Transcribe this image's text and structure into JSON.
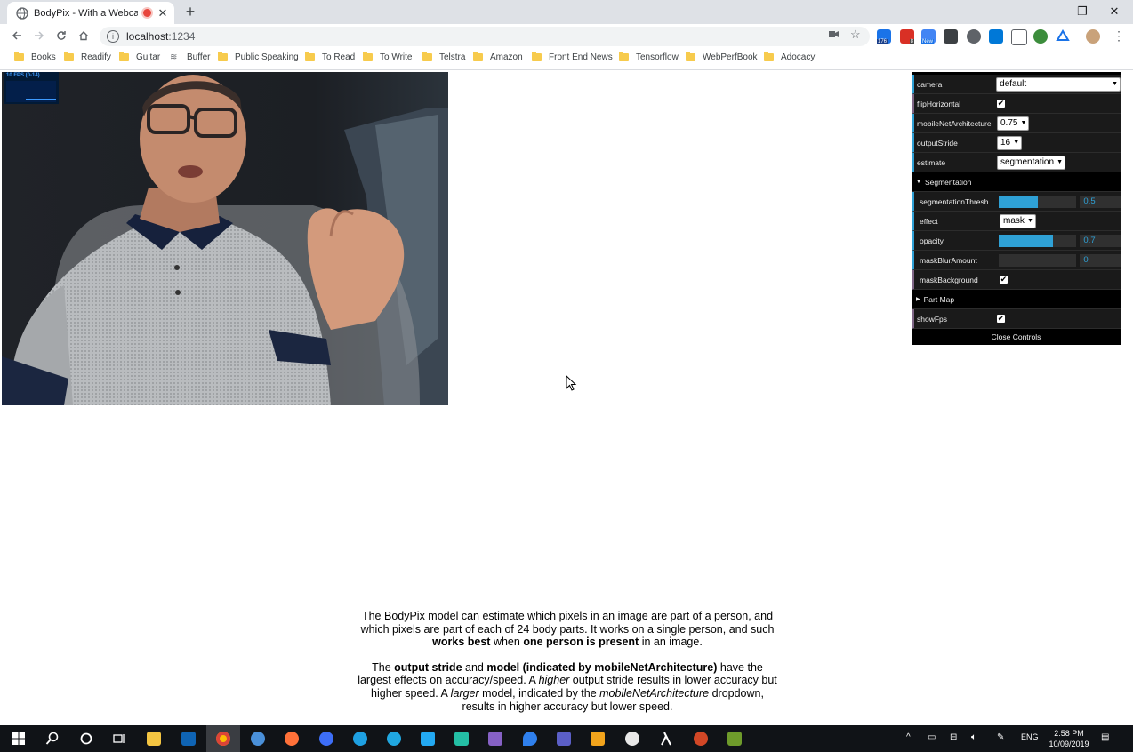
{
  "browser": {
    "tab_title": "BodyPix - With a Webcam D",
    "tab_close": "✕",
    "new_tab": "+",
    "url_host": "localhost",
    "url_port": ":1234",
    "window_controls": [
      "—",
      "❐",
      "✕"
    ],
    "extension_badges": [
      "176",
      "8",
      "New"
    ]
  },
  "bookmarks": [
    {
      "label": "Books",
      "icon": "folder-icon"
    },
    {
      "label": "Readify",
      "icon": "folder-icon"
    },
    {
      "label": "Guitar",
      "icon": "folder-icon"
    },
    {
      "label": "Buffer",
      "icon": "buffer-icon"
    },
    {
      "label": "Public Speaking",
      "icon": "folder-icon"
    },
    {
      "label": "To Read",
      "icon": "folder-icon"
    },
    {
      "label": "To Write",
      "icon": "folder-icon"
    },
    {
      "label": "Telstra",
      "icon": "folder-icon"
    },
    {
      "label": "Amazon",
      "icon": "folder-icon"
    },
    {
      "label": "Front End News",
      "icon": "folder-icon"
    },
    {
      "label": "Tensorflow",
      "icon": "folder-icon"
    },
    {
      "label": "WebPerfBook",
      "icon": "folder-icon"
    },
    {
      "label": "Adocacy",
      "icon": "folder-icon"
    }
  ],
  "stats": {
    "fps_label": "10 FPS (0-14)"
  },
  "gui": {
    "camera": {
      "label": "camera",
      "value": "default"
    },
    "flipHorizontal": {
      "label": "flipHorizontal",
      "checked": true
    },
    "mobileNetArchitecture": {
      "label": "mobileNetArchitecture",
      "value": "0.75"
    },
    "outputStride": {
      "label": "outputStride",
      "value": "16"
    },
    "estimate": {
      "label": "estimate",
      "value": "segmentation"
    },
    "segmentation_folder": "Segmentation",
    "segmentationThreshold": {
      "label": "segmentationThresh..",
      "value": "0.5",
      "fraction": 0.5
    },
    "effect": {
      "label": "effect",
      "value": "mask"
    },
    "opacity": {
      "label": "opacity",
      "value": "0.7",
      "fraction": 0.7
    },
    "maskBlurAmount": {
      "label": "maskBlurAmount",
      "value": "0",
      "fraction": 0
    },
    "maskBackground": {
      "label": "maskBackground",
      "checked": true
    },
    "partmap_folder": "Part Map",
    "showFps": {
      "label": "showFps",
      "checked": true
    },
    "close_controls": "Close Controls",
    "check_glyph": "✔"
  },
  "description": {
    "p1": {
      "t1": "The BodyPix model can estimate which pixels in an image are part of a person, and which pixels are part of each of 24 body parts. It works on a single person, and such ",
      "b1": "works best",
      "t2": " when ",
      "b2": "one person is present",
      "t3": " in an image."
    },
    "p2": {
      "t1": "The ",
      "b1": "output stride",
      "t2": " and ",
      "b2": "model (indicated by mobileNetArchitecture)",
      "t3": " have the largest effects on accuracy/speed. A ",
      "i1": "higher",
      "t4": " output stride results in lower accuracy but higher speed. A ",
      "i2": "larger",
      "t5": " model, indicated by the ",
      "i3": "mobileNetArchitecture",
      "t6": " dropdown, results in higher accuracy but lower speed."
    }
  },
  "taskbar": {
    "language": "ENG",
    "time": "2:58 PM",
    "date": "10/09/2019"
  }
}
